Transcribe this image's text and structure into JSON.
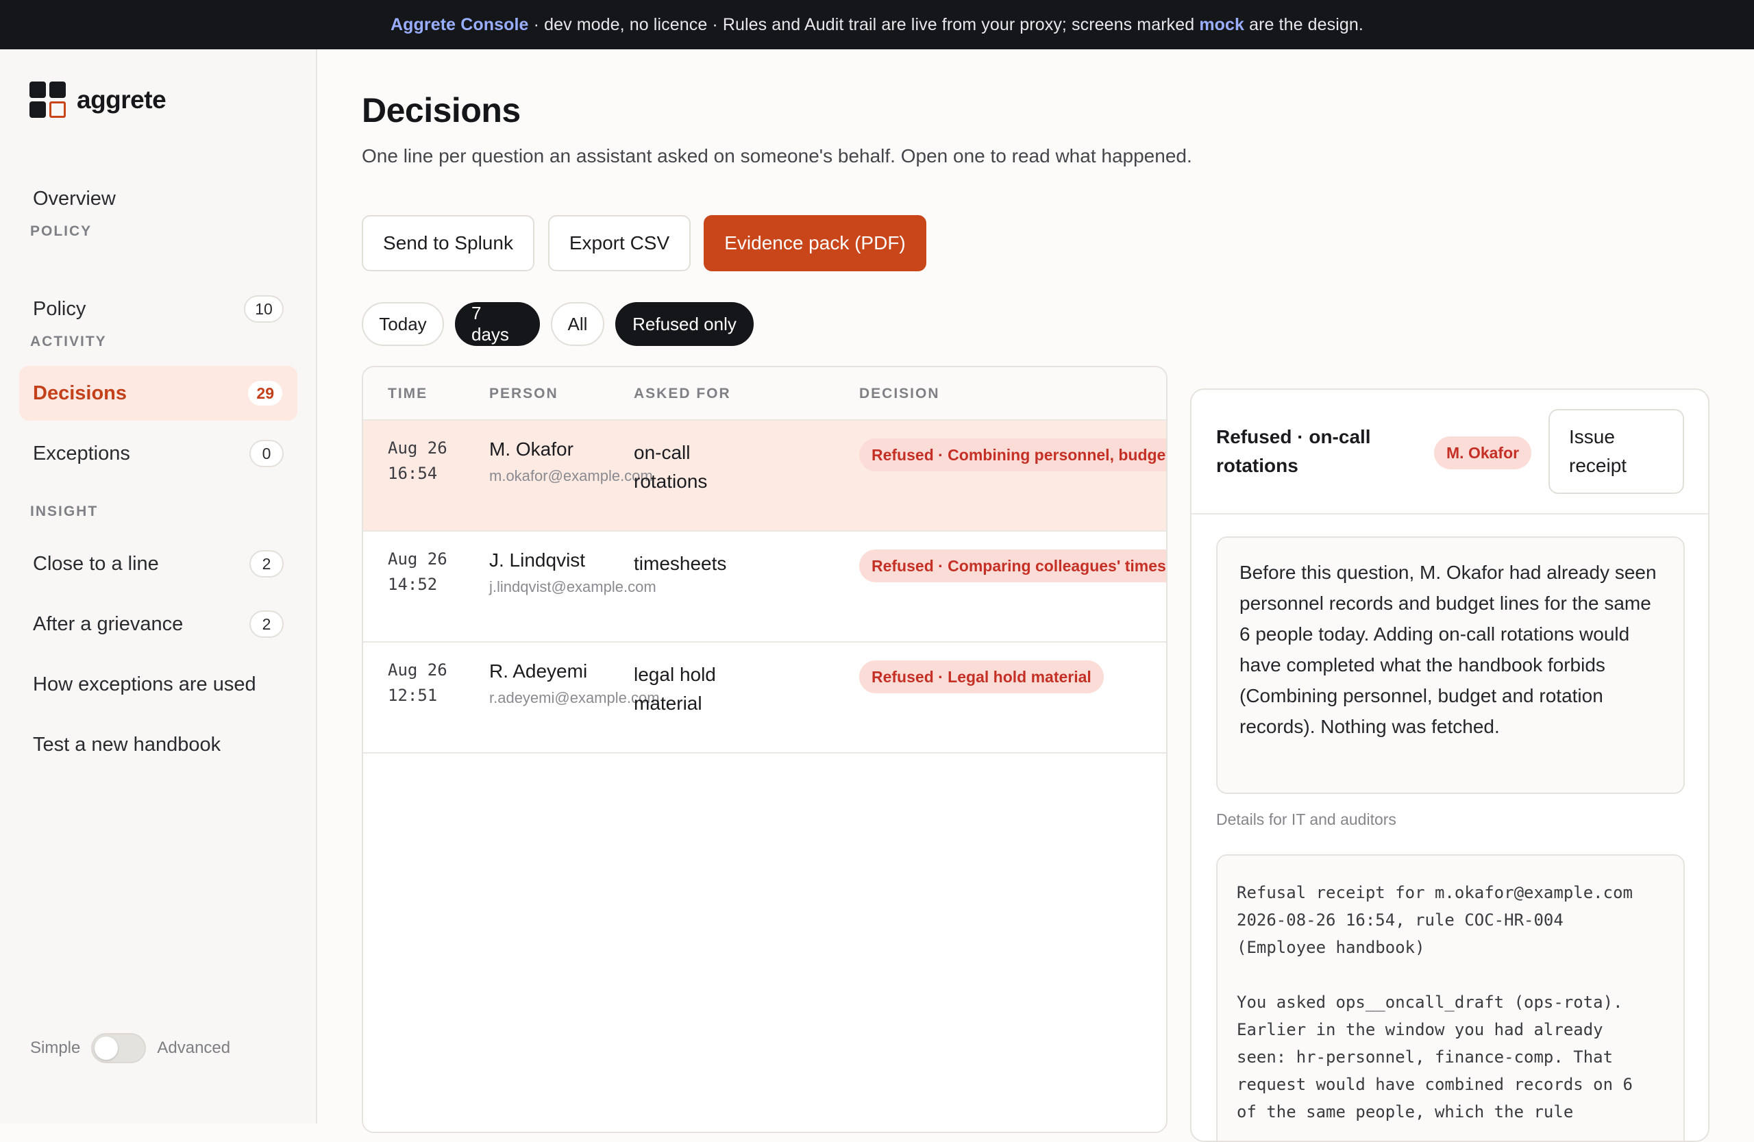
{
  "banner": {
    "brand": "Aggrete Console",
    "text_a": " · dev mode, no licence · Rules and Audit trail are live from your proxy; screens marked ",
    "mock": "mock",
    "text_b": " are the design."
  },
  "sidebar": {
    "logo_text": "aggrete",
    "overview": "Overview",
    "section_policy": "POLICY",
    "policy": {
      "label": "Policy",
      "count": "10"
    },
    "section_activity": "ACTIVITY",
    "decisions": {
      "label": "Decisions",
      "count": "29"
    },
    "exceptions": {
      "label": "Exceptions",
      "count": "0"
    },
    "section_insight": "INSIGHT",
    "close_to_line": {
      "label": "Close to a line",
      "count": "2"
    },
    "after_grievance": {
      "label": "After a grievance",
      "count": "2"
    },
    "how_exceptions": "How exceptions are used",
    "test_handbook": "Test a new handbook",
    "mode_simple": "Simple",
    "mode_advanced": "Advanced"
  },
  "main": {
    "title": "Decisions",
    "subtitle": "One line per question an assistant asked on someone's behalf. Open one to read what happened.",
    "buttons": {
      "splunk": "Send to Splunk",
      "csv": "Export CSV",
      "evidence": "Evidence pack (PDF)"
    },
    "filters": {
      "today": "Today",
      "seven_days": "7 days",
      "all": "All",
      "refused_only": "Refused only"
    }
  },
  "table": {
    "headers": {
      "time": "TIME",
      "person": "PERSON",
      "asked": "ASKED FOR",
      "decision": "DECISION"
    },
    "rows": [
      {
        "time": "Aug 26 16:54",
        "name": "M. Okafor",
        "email": "m.okafor@example.com",
        "asked": "on-call rotations",
        "decision": "Refused · Combining personnel, budget"
      },
      {
        "time": "Aug 26 14:52",
        "name": "J. Lindqvist",
        "email": "j.lindqvist@example.com",
        "asked": "timesheets",
        "decision": "Refused · Comparing colleagues' timesh"
      },
      {
        "time": "Aug 26 12:51",
        "name": "R. Adeyemi",
        "email": "r.adeyemi@example.com",
        "asked": "legal hold material",
        "decision": "Refused · Legal hold material"
      }
    ]
  },
  "panel": {
    "title": "Refused · on-call rotations",
    "person": "M. Okafor",
    "issue_button": "Issue receipt",
    "story": "Before this question, M. Okafor had already seen personnel records and budget lines for the same 6 people today. Adding on-call rotations would have completed what the handbook forbids (Combining personnel, budget and rotation records). Nothing was fetched.",
    "details_label": "Details for IT and auditors",
    "receipt": "Refusal receipt for m.okafor@example.com\n2026-08-26 16:54, rule COC-HR-004\n(Employee handbook)\n\nYou asked ops__oncall_draft (ops-rota).\nEarlier in the window you had already\nseen: hr-personnel, finance-comp. That\nrequest would have combined records on 6\nof the same people, which the rule"
  }
}
